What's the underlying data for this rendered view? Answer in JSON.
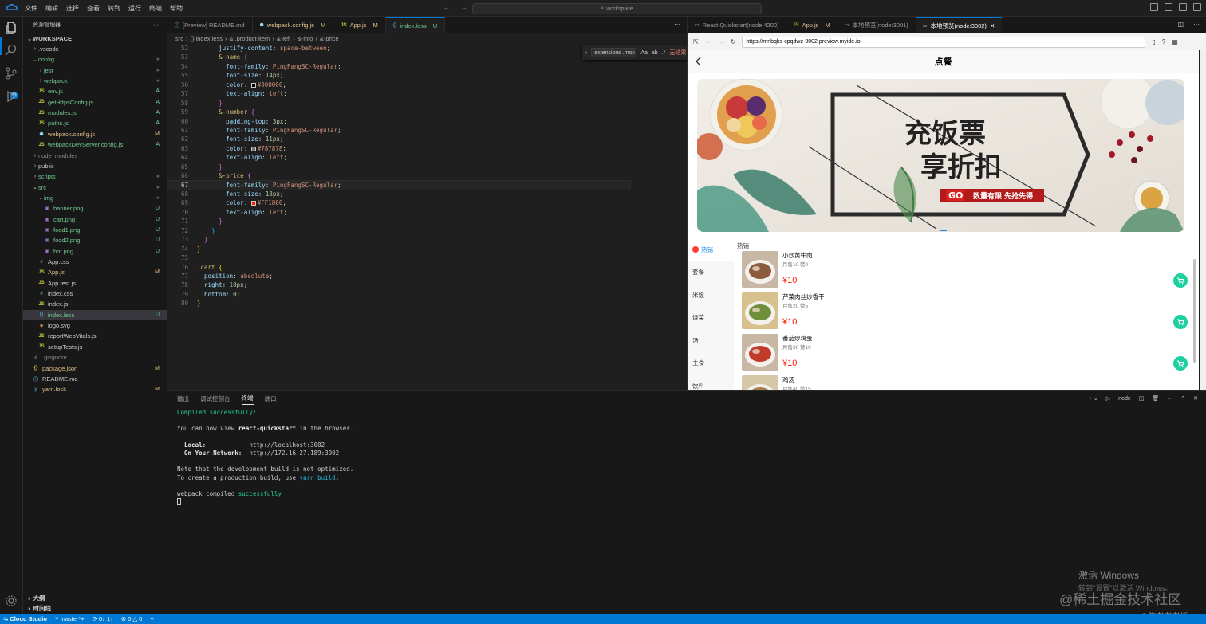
{
  "titlebar": {
    "menu": [
      "文件",
      "编辑",
      "选择",
      "查看",
      "转到",
      "运行",
      "终端",
      "帮助"
    ],
    "search_text": "workspace"
  },
  "activity": {
    "badge": "23"
  },
  "sidebar": {
    "title": "资源管理器",
    "workspace": "WORKSPACE",
    "items": [
      {
        "label": ".vscode",
        "type": "folder",
        "depth": 1,
        "open": false,
        "status": ""
      },
      {
        "label": "config",
        "type": "folder",
        "depth": 1,
        "open": true,
        "status": "●"
      },
      {
        "label": "jest",
        "type": "folder",
        "depth": 2,
        "open": false,
        "status": "●"
      },
      {
        "label": "webpack",
        "type": "folder",
        "depth": 2,
        "open": false,
        "status": "●"
      },
      {
        "label": "env.js",
        "type": "js",
        "depth": 2,
        "status": "A"
      },
      {
        "label": "getHttpsConfig.js",
        "type": "js",
        "depth": 2,
        "status": "A"
      },
      {
        "label": "modules.js",
        "type": "js",
        "depth": 2,
        "status": "A"
      },
      {
        "label": "paths.js",
        "type": "js",
        "depth": 2,
        "status": "A"
      },
      {
        "label": "webpack.config.js",
        "type": "webpack",
        "depth": 2,
        "status": "M"
      },
      {
        "label": "webpackDevServer.config.js",
        "type": "js",
        "depth": 2,
        "status": "A"
      },
      {
        "label": "node_modules",
        "type": "folder",
        "depth": 1,
        "open": false,
        "status": ""
      },
      {
        "label": "public",
        "type": "folder",
        "depth": 1,
        "open": false,
        "status": ""
      },
      {
        "label": "scripts",
        "type": "folder",
        "depth": 1,
        "open": false,
        "status": "●"
      },
      {
        "label": "src",
        "type": "folder",
        "depth": 1,
        "open": true,
        "status": "●"
      },
      {
        "label": "img",
        "type": "folder",
        "depth": 2,
        "open": true,
        "status": "●"
      },
      {
        "label": "banner.png",
        "type": "img",
        "depth": 3,
        "status": "U"
      },
      {
        "label": "cart.png",
        "type": "img",
        "depth": 3,
        "status": "U"
      },
      {
        "label": "food1.png",
        "type": "img",
        "depth": 3,
        "status": "U"
      },
      {
        "label": "food2.png",
        "type": "img",
        "depth": 3,
        "status": "U"
      },
      {
        "label": "hot.png",
        "type": "img",
        "depth": 3,
        "status": "U"
      },
      {
        "label": "App.css",
        "type": "css",
        "depth": 2,
        "status": ""
      },
      {
        "label": "App.js",
        "type": "js",
        "depth": 2,
        "status": "M"
      },
      {
        "label": "App.test.js",
        "type": "js",
        "depth": 2,
        "status": ""
      },
      {
        "label": "index.css",
        "type": "css",
        "depth": 2,
        "status": ""
      },
      {
        "label": "index.js",
        "type": "js",
        "depth": 2,
        "status": ""
      },
      {
        "label": "index.less",
        "type": "less",
        "depth": 2,
        "status": "U",
        "active": true
      },
      {
        "label": "logo.svg",
        "type": "svg",
        "depth": 2,
        "status": ""
      },
      {
        "label": "reportWebVitals.js",
        "type": "js",
        "depth": 2,
        "status": ""
      },
      {
        "label": "setupTests.js",
        "type": "js",
        "depth": 2,
        "status": ""
      },
      {
        "label": ".gitignore",
        "type": "git",
        "depth": 1,
        "status": ""
      },
      {
        "label": "package.json",
        "type": "json",
        "depth": 1,
        "status": "M"
      },
      {
        "label": "README.md",
        "type": "info",
        "depth": 1,
        "status": ""
      },
      {
        "label": "yarn.lock",
        "type": "yarn",
        "depth": 1,
        "status": "M"
      }
    ],
    "outline": "大纲",
    "timeline": "时间线"
  },
  "editor": {
    "tabs": [
      {
        "label": "[Preview] README.md",
        "mark": "",
        "active": false
      },
      {
        "label": "webpack.config.js",
        "mark": "M",
        "active": false
      },
      {
        "label": "App.js",
        "mark": "M",
        "active": false
      },
      {
        "label": "index.less",
        "mark": "U",
        "active": true
      }
    ],
    "breadcrumb": [
      "src",
      "{} index.less",
      "& .product-item",
      "&-left",
      "&-info",
      "&-price"
    ],
    "find": {
      "query": "extensions .moc",
      "aa": "Aa",
      "result": "无结果"
    },
    "current_line": "67",
    "lines": [
      {
        "n": "52",
        "html": "      <span class=\"k\">justify-content</span>: <span class=\"v\">space-between</span>;"
      },
      {
        "n": "53",
        "html": "      <span class=\"s\">&amp;-name</span> <span class=\"pp\">{</span>"
      },
      {
        "n": "54",
        "html": "        <span class=\"k\">font-family</span>: <span class=\"v\">PingFangSC-Regular</span>;"
      },
      {
        "n": "55",
        "html": "        <span class=\"k\">font-size</span>: <span class=\"n\">14px</span>;"
      },
      {
        "n": "56",
        "html": "        <span class=\"k\">color</span>: <i class=\"swatch\" style=\"background:#000000\"></i><span class=\"v\">#000000</span>;"
      },
      {
        "n": "57",
        "html": "        <span class=\"k\">text-align</span>: <span class=\"v\">left</span>;"
      },
      {
        "n": "58",
        "html": "      <span class=\"pp\">}</span>"
      },
      {
        "n": "59",
        "html": "      <span class=\"s\">&amp;-number</span> <span class=\"pp\">{</span>"
      },
      {
        "n": "60",
        "html": "        <span class=\"k\">padding-top</span>: <span class=\"n\">3px</span>;"
      },
      {
        "n": "61",
        "html": "        <span class=\"k\">font-family</span>: <span class=\"v\">PingFangSC-Regular</span>;"
      },
      {
        "n": "62",
        "html": "        <span class=\"k\">font-size</span>: <span class=\"n\">11px</span>;"
      },
      {
        "n": "63",
        "html": "        <span class=\"k\">color</span>: <i class=\"swatch\" style=\"background:#787878\"></i><span class=\"v\">#787878</span>;"
      },
      {
        "n": "64",
        "html": "        <span class=\"k\">text-align</span>: <span class=\"v\">left</span>;"
      },
      {
        "n": "65",
        "html": "      <span class=\"pp\">}</span>"
      },
      {
        "n": "66",
        "html": "      <span class=\"s\">&amp;-price</span> <span class=\"pp\">{</span>"
      },
      {
        "n": "67",
        "html": "        <span class=\"k\">font-family</span>: <span class=\"v\">PingFangSC-Regular</span>;"
      },
      {
        "n": "68",
        "html": "        <span class=\"k\">font-size</span>: <span class=\"n\">18px</span>;"
      },
      {
        "n": "69",
        "html": "        <span class=\"k\">color</span>: <i class=\"swatch\" style=\"background:#FF1800\"></i><span class=\"v\">#FF1800</span>;"
      },
      {
        "n": "70",
        "html": "        <span class=\"k\">text-align</span>: <span class=\"v\">left</span>;"
      },
      {
        "n": "71",
        "html": "      <span class=\"pp\">}</span>"
      },
      {
        "n": "72",
        "html": "    <span class=\"c2\">}</span>"
      },
      {
        "n": "73",
        "html": "  <span class=\"pp\">}</span>"
      },
      {
        "n": "74",
        "html": "<span class=\"p\">}</span>"
      },
      {
        "n": "75",
        "html": ""
      },
      {
        "n": "76",
        "html": "<span class=\"s\">.cart</span> <span class=\"p\">{</span>"
      },
      {
        "n": "77",
        "html": "  <span class=\"k\">position</span>: <span class=\"v\">absolute</span>;"
      },
      {
        "n": "78",
        "html": "  <span class=\"k\">right</span>: <span class=\"n\">10px</span>;"
      },
      {
        "n": "79",
        "html": "  <span class=\"k\">bottom</span>: <span class=\"n\">0</span>;"
      },
      {
        "n": "80",
        "html": "<span class=\"p\">}</span>"
      }
    ]
  },
  "browser": {
    "tabs": [
      {
        "label": "React Quickstart(node:4200)",
        "mark": "",
        "active": false
      },
      {
        "label": "App.js",
        "mark": "M",
        "active": false
      },
      {
        "label": "本地预览(node:3001)",
        "mark": "",
        "active": false
      },
      {
        "label": "本地预览(node:3002)",
        "mark": "",
        "active": true
      }
    ],
    "url": "https://mnbqks-cpqdwz-3002.preview.myide.io",
    "page": {
      "title": "点餐",
      "banner": {
        "line1": "充饭票",
        "line2": "享折扣",
        "go": "GO",
        "slogan": "数量有限 先抢先得"
      },
      "categories": [
        "热销",
        "套餐",
        "米饭",
        "烧菜",
        "汤",
        "主食",
        "饮料"
      ],
      "section": "热销",
      "products": [
        {
          "name": "小炒黄牛肉",
          "info": "月售10 赞0",
          "price": "¥10"
        },
        {
          "name": "芹菜肉丝炒香干",
          "info": "月售20 赞5",
          "price": "¥10"
        },
        {
          "name": "番茄炒鸡蛋",
          "info": "月售30 赞10",
          "price": "¥10"
        },
        {
          "name": "鸡汤",
          "info": "月售40 赞15",
          "price": ""
        }
      ]
    }
  },
  "panel": {
    "tabs": [
      "输出",
      "调试控制台",
      "终端",
      "端口"
    ],
    "active_tab": "终端",
    "shell": "node",
    "terminal": {
      "compiled": "Compiled successfully!",
      "view_pre": "You can now view ",
      "view_app": "react-quickstart",
      "view_post": " in the browser.",
      "local_label": "  Local:",
      "local_url": "http://localhost:3002",
      "network_label": "  On Your Network:",
      "network_url": "http://172.16.27.189:3002",
      "note1": "Note that the development build is not optimized.",
      "note2_pre": "To create a production build, use ",
      "note2_cmd": "yarn build",
      "note2_post": ".",
      "webpack_pre": "webpack compiled ",
      "webpack_ok": "successfully"
    }
  },
  "watermark": {
    "activate": "激活 Windows",
    "activate_sub": "转到\"设置\"以激活 Windows。",
    "site": "@稀土掘金技术社区",
    "csdn": "CSDN @陈老老老板"
  },
  "statusbar": {
    "studio": "Cloud Studio",
    "branch": "master*+",
    "sync": "0↓ 1↑",
    "errors": "0",
    "warnings": "0"
  },
  "colors": {
    "accent": "#0078d4",
    "price": "#FF1800",
    "cart": "#1ecfa0",
    "modified": "#e2c08d",
    "untracked": "#73c991",
    "added": "#73c991"
  }
}
